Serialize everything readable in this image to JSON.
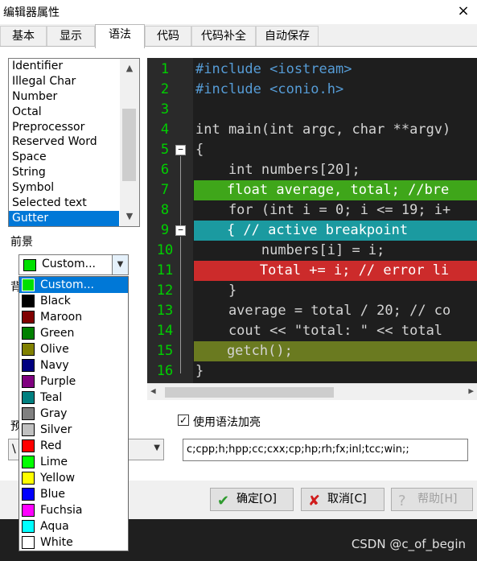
{
  "window": {
    "title": "编辑器属性",
    "close_icon": "×"
  },
  "tabs": [
    {
      "label": "基本"
    },
    {
      "label": "显示"
    },
    {
      "label": "语法",
      "active": true
    },
    {
      "label": "代码"
    },
    {
      "label": "代码补全"
    },
    {
      "label": "自动保存"
    }
  ],
  "token_list": {
    "items": [
      "Identifier",
      "Illegal Char",
      "Number",
      "Octal",
      "Preprocessor",
      "Reserved Word",
      "Space",
      "String",
      "Symbol",
      "Selected text",
      "Gutter"
    ],
    "selected": "Gutter"
  },
  "labels": {
    "foreground": "前景",
    "background": "背",
    "preset": "预"
  },
  "foreground_combo": {
    "value": "Custom...",
    "color": "#00e000"
  },
  "color_options": [
    {
      "name": "Custom...",
      "color": "#00e000"
    },
    {
      "name": "Black",
      "color": "#000000"
    },
    {
      "name": "Maroon",
      "color": "#800000"
    },
    {
      "name": "Green",
      "color": "#008000"
    },
    {
      "name": "Olive",
      "color": "#808000"
    },
    {
      "name": "Navy",
      "color": "#000080"
    },
    {
      "name": "Purple",
      "color": "#800080"
    },
    {
      "name": "Teal",
      "color": "#008080"
    },
    {
      "name": "Gray",
      "color": "#808080"
    },
    {
      "name": "Silver",
      "color": "#c0c0c0"
    },
    {
      "name": "Red",
      "color": "#ff0000"
    },
    {
      "name": "Lime",
      "color": "#00ff00"
    },
    {
      "name": "Yellow",
      "color": "#ffff00"
    },
    {
      "name": "Blue",
      "color": "#0000ff"
    },
    {
      "name": "Fuchsia",
      "color": "#ff00ff"
    },
    {
      "name": "Aqua",
      "color": "#00ffff"
    },
    {
      "name": "White",
      "color": "#ffffff"
    }
  ],
  "preset_combo": {
    "value": "\\"
  },
  "preview": {
    "lines": [
      {
        "n": "1",
        "code": "#include <iostream>"
      },
      {
        "n": "2",
        "code": "#include <conio.h>"
      },
      {
        "n": "3",
        "code": ""
      },
      {
        "n": "4",
        "code": "int main(int argc, char **argv)"
      },
      {
        "n": "5",
        "code": "{"
      },
      {
        "n": "6",
        "code": "    int numbers[20];"
      },
      {
        "n": "7",
        "code": "    float average, total; //bre"
      },
      {
        "n": "8",
        "code": "    for (int i = 0; i <= 19; i+"
      },
      {
        "n": "9",
        "code": "    { // active breakpoint"
      },
      {
        "n": "10",
        "code": "        numbers[i] = i;"
      },
      {
        "n": "11",
        "code": "        Total += i; // error li"
      },
      {
        "n": "12",
        "code": "    }"
      },
      {
        "n": "13",
        "code": "    average = total / 20; // co"
      },
      {
        "n": "14",
        "code": "    cout << \"total: \" << total"
      },
      {
        "n": "15",
        "code": "    getch();"
      },
      {
        "n": "16",
        "code": "}"
      }
    ]
  },
  "syntax_highlight_checkbox": {
    "label": "使用语法加亮",
    "checked": true,
    "mark": "✓"
  },
  "extensions_field": {
    "value": "c;cpp;h;hpp;cc;cxx;cp;hp;rh;fx;inl;tcc;win;;"
  },
  "buttons": {
    "ok": {
      "label": "确定[O]"
    },
    "cancel": {
      "label": "取消[C]"
    },
    "help": {
      "label": "帮助[H]"
    }
  },
  "watermark": "CSDN @c_of_begin"
}
